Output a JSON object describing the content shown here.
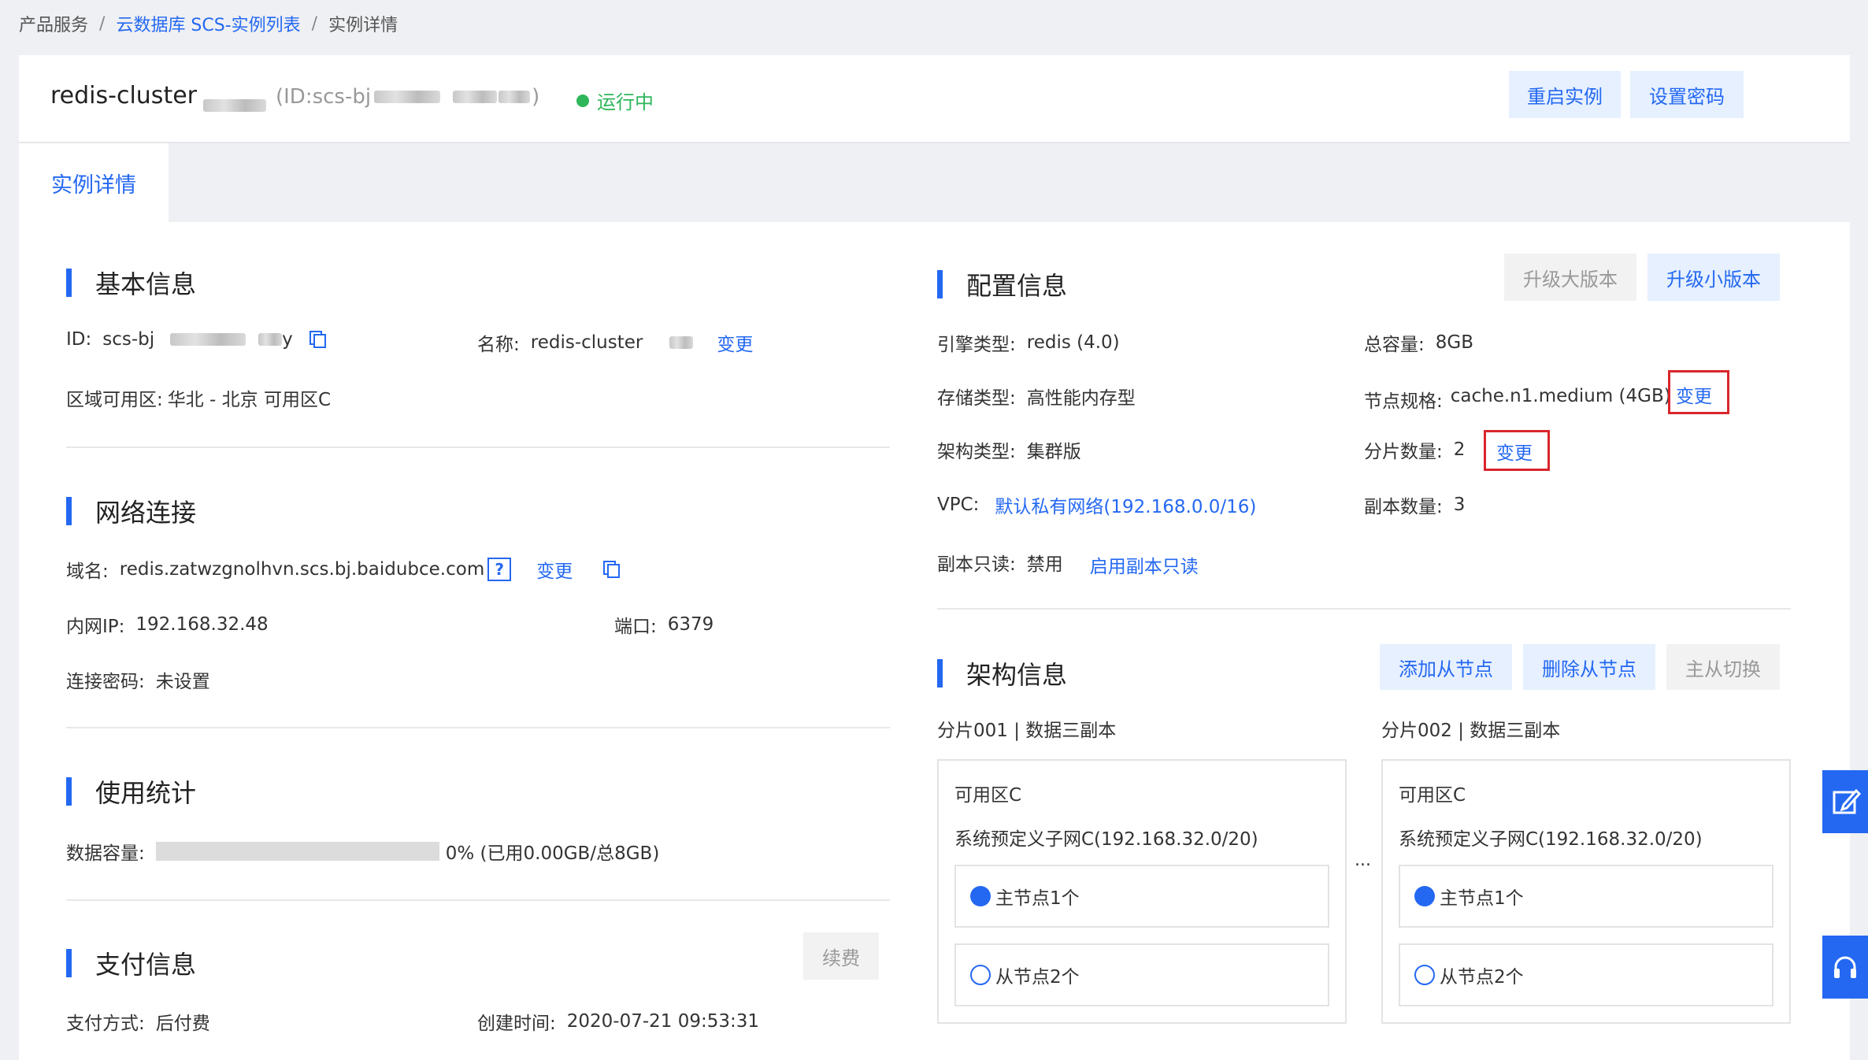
{
  "breadcrumb": {
    "item1": "产品服务",
    "sep": "/",
    "item2": "云数据库 SCS-实例列表",
    "item3": "实例详情"
  },
  "header": {
    "instance_name": "redis-cluster",
    "id_prefix": "(ID:scs-bj",
    "id_suffix": ")",
    "status": "运行中",
    "restart_button": "重启实例",
    "set_password_button": "设置密码"
  },
  "tabs": [
    {
      "label": "实例详情"
    }
  ],
  "basic_info": {
    "title": "基本信息",
    "id_label": "ID:",
    "id_value_prefix": "scs-bj",
    "id_value_suffix": "y",
    "name_label": "名称:",
    "name_value": "redis-cluster",
    "name_change": "变更",
    "region_label": "区域可用区:",
    "region_value": "华北 - 北京 可用区C"
  },
  "network": {
    "title": "网络连接",
    "domain_label": "域名:",
    "domain_value": "redis.zatwzgnolhvn.scs.bj.baidubce.com",
    "domain_change": "变更",
    "ip_label": "内网IP:",
    "ip_value": "192.168.32.48",
    "port_label": "端口:",
    "port_value": "6379",
    "password_label": "连接密码:",
    "password_value": "未设置"
  },
  "usage": {
    "title": "使用统计",
    "capacity_label": "数据容量:",
    "capacity_text": "0% (已用0.00GB/总8GB)",
    "capacity_percent": 0
  },
  "payment": {
    "title": "支付信息",
    "renew_button": "续费",
    "method_label": "支付方式:",
    "method_value": "后付费",
    "created_label": "创建时间:",
    "created_value": "2020-07-21 09:53:31"
  },
  "config": {
    "title": "配置信息",
    "upgrade_major_button": "升级大版本",
    "upgrade_minor_button": "升级小版本",
    "engine_label": "引擎类型:",
    "engine_value": "redis (4.0)",
    "total_label": "总容量:",
    "total_value": "8GB",
    "storage_label": "存储类型:",
    "storage_value": "高性能内存型",
    "spec_label": "节点规格:",
    "spec_value": "cache.n1.medium (4GB)",
    "spec_change": "变更",
    "arch_label": "架构类型:",
    "arch_value": "集群版",
    "shard_label": "分片数量:",
    "shard_value": "2",
    "shard_change": "变更",
    "vpc_label": "VPC:",
    "vpc_value": "默认私有网络(192.168.0.0/16)",
    "replica_label": "副本数量:",
    "replica_value": "3",
    "readonly_label": "副本只读:",
    "readonly_value": "禁用",
    "readonly_enable": "启用副本只读"
  },
  "architecture": {
    "title": "架构信息",
    "add_slave_button": "添加从节点",
    "delete_slave_button": "删除从节点",
    "switch_button": "主从切换",
    "ellipsis": "...",
    "shards": [
      {
        "title": "分片001 | 数据三副本",
        "zone": "可用区C",
        "subnet": "系统预定义子网C(192.168.32.0/20)",
        "master": "主节点1个",
        "slave": "从节点2个"
      },
      {
        "title": "分片002 | 数据三副本",
        "zone": "可用区C",
        "subnet": "系统预定义子网C(192.168.32.0/20)",
        "master": "主节点1个",
        "slave": "从节点2个"
      }
    ]
  },
  "floating": {
    "edit_icon": "edit-icon",
    "support_icon": "headset-icon"
  },
  "colors": {
    "accent": "#2468f2",
    "status_green": "#2fb65b",
    "highlight_red": "#d9262c"
  }
}
